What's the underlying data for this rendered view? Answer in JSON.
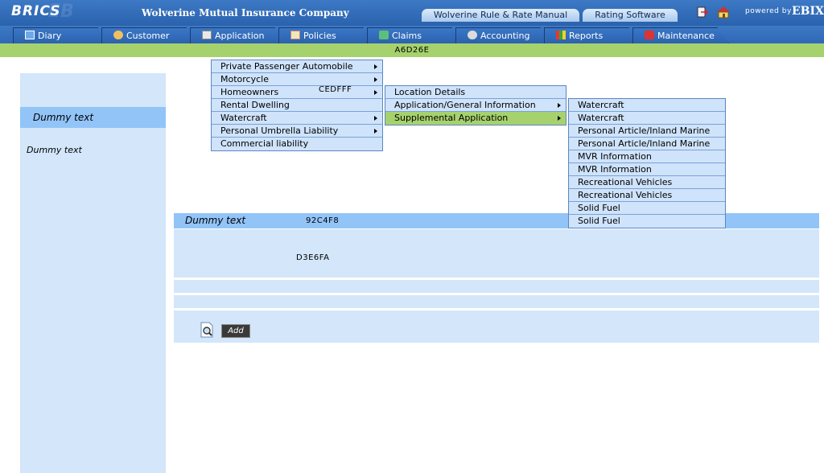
{
  "header": {
    "logo": "BRICS",
    "company": "Wolverine Mutual Insurance Company",
    "links": [
      "Wolverine Rule & Rate Manual",
      "Rating Software"
    ],
    "powered_by": "powered by",
    "brand": "EBIX",
    "icons": [
      "exit-icon",
      "home-icon"
    ]
  },
  "tabs": [
    {
      "label": "Diary",
      "icon": "diary-icon"
    },
    {
      "label": "Customer",
      "icon": "customer-icon"
    },
    {
      "label": "Application",
      "icon": "application-icon"
    },
    {
      "label": "Policies",
      "icon": "policies-icon"
    },
    {
      "label": "Claims",
      "icon": "claims-icon"
    },
    {
      "label": "Accounting",
      "icon": "accounting-icon"
    },
    {
      "label": "Reports",
      "icon": "reports-icon"
    },
    {
      "label": "Maintenance",
      "icon": "maintenance-icon"
    }
  ],
  "green_bar_text": "A6D26E",
  "left_panel": {
    "heading": "Dummy text",
    "text": "Dummy text"
  },
  "main": {
    "heading": "Dummy text",
    "heading_code": "92C4F8",
    "body_code": "D3E6FA",
    "add_label": "Add"
  },
  "menu1": {
    "code": "CEDFFF",
    "items": [
      {
        "label": "Private Passenger Automobile",
        "submenu": true
      },
      {
        "label": "Motorcycle",
        "submenu": true
      },
      {
        "label": "Homeowners",
        "submenu": true
      },
      {
        "label": "Rental Dwelling",
        "submenu": false
      },
      {
        "label": "Watercraft",
        "submenu": true
      },
      {
        "label": "Personal Umbrella Liability",
        "submenu": true
      },
      {
        "label": "Commercial liability",
        "submenu": false
      }
    ]
  },
  "menu2": {
    "items": [
      {
        "label": "Location Details",
        "submenu": false
      },
      {
        "label": "Application/General Information",
        "submenu": true
      },
      {
        "label": "Supplemental Application",
        "submenu": true,
        "selected": true
      }
    ]
  },
  "menu3": {
    "items": [
      {
        "label": "Watercraft"
      },
      {
        "label": "Watercraft"
      },
      {
        "label": "Personal Article/Inland Marine"
      },
      {
        "label": "Personal Article/Inland Marine"
      },
      {
        "label": "MVR Information"
      },
      {
        "label": "MVR Information"
      },
      {
        "label": "Recreational Vehicles"
      },
      {
        "label": "Recreational Vehicles"
      },
      {
        "label": "Solid Fuel"
      },
      {
        "label": "Solid Fuel"
      }
    ]
  },
  "colors": {
    "header_blue": "#2f68b6",
    "green_bar": "#A6D26E",
    "panel_light": "#D3E6FA",
    "panel_mid": "#92C4F8",
    "menu_bg": "#CEDFFF"
  }
}
